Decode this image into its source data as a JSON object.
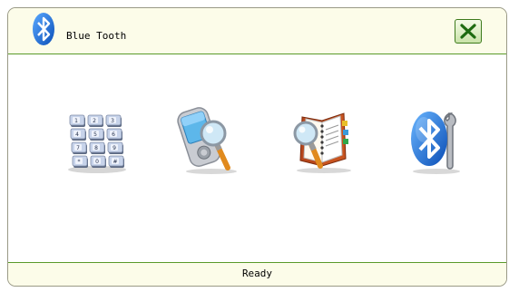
{
  "window": {
    "title": "Blue Tooth",
    "close_icon": "close-x-icon"
  },
  "tools": [
    {
      "name": "dial-pad",
      "icon": "keypad-icon"
    },
    {
      "name": "search-device",
      "icon": "pda-magnifier-icon"
    },
    {
      "name": "phonebook",
      "icon": "address-book-magnifier-icon"
    },
    {
      "name": "bluetooth-settings",
      "icon": "bluetooth-wrench-icon"
    }
  ],
  "keypad_labels": [
    "1",
    "2",
    "3",
    "4",
    "5",
    "6",
    "7",
    "8",
    "9",
    "*",
    "0",
    "#"
  ],
  "status": {
    "text": "Ready"
  },
  "colors": {
    "frame_border": "#5a9a2a",
    "bar_bg": "#fcfce9",
    "bluetooth_blue": "#1d6fd6"
  }
}
